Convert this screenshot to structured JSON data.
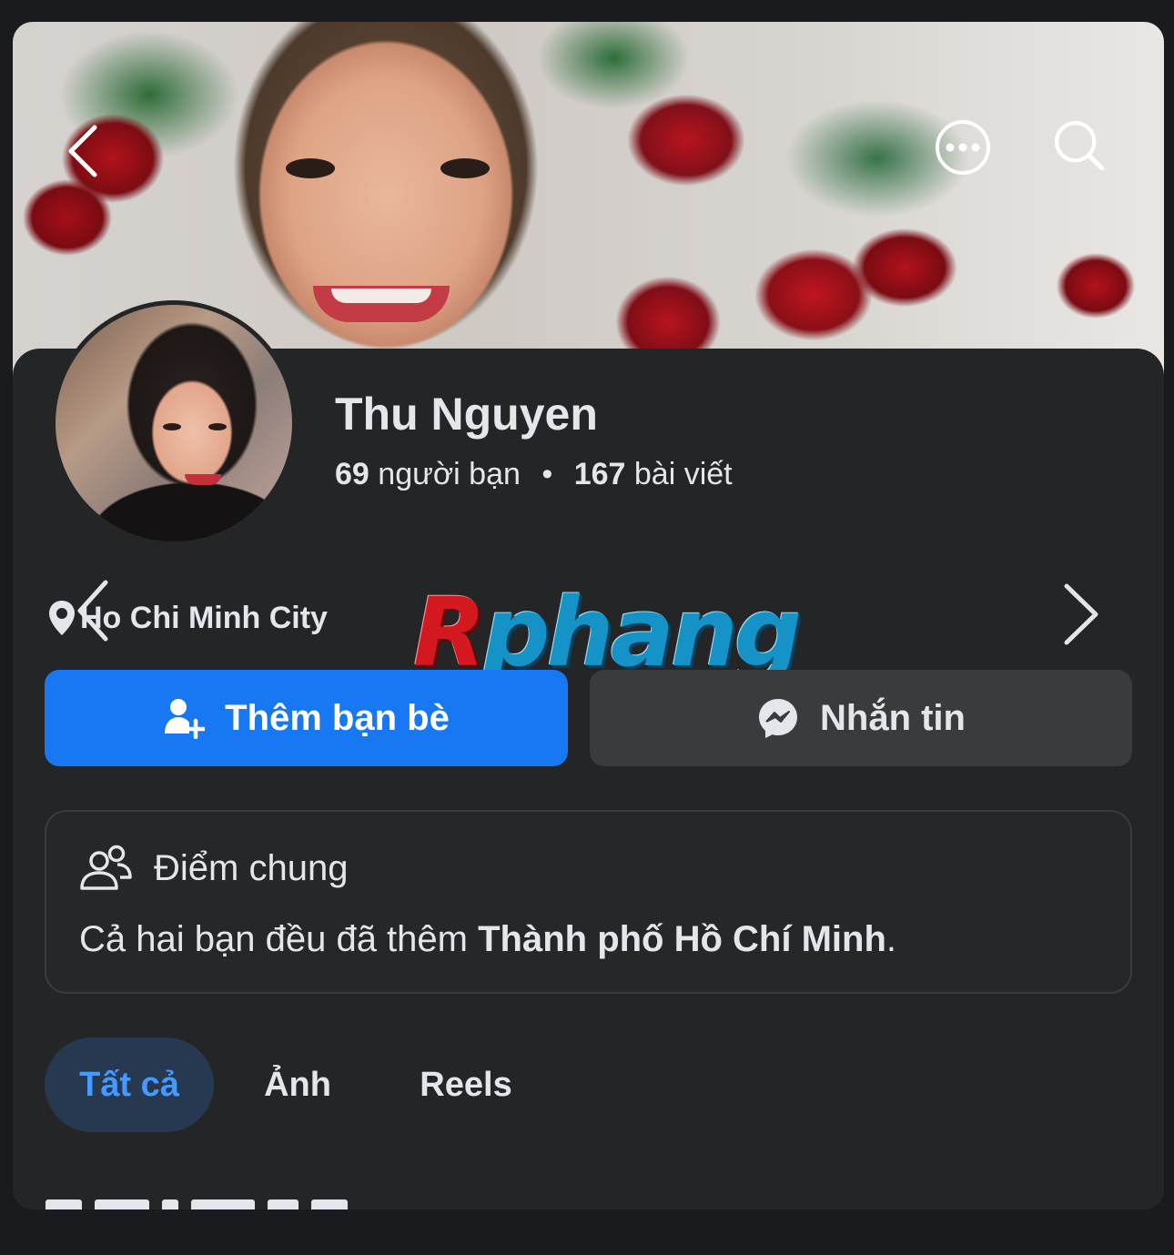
{
  "header": {
    "back_icon": "chevron-left-icon",
    "more_icon": "more-dots-icon",
    "search_icon": "search-icon"
  },
  "profile": {
    "name": "Thu Nguyen",
    "friends_count": "69",
    "friends_label": "người bạn",
    "posts_count": "167",
    "posts_label": "bài viết"
  },
  "location": {
    "text": "Ho Chi Minh City",
    "pin_icon": "location-pin-icon",
    "prev_icon": "chevron-left-icon",
    "next_icon": "chevron-right-icon"
  },
  "watermark": {
    "first": "R",
    "rest": "phang"
  },
  "actions": {
    "add_friend_label": "Thêm bạn bè",
    "message_label": "Nhắn tin",
    "add_friend_color": "#1877f2"
  },
  "common": {
    "title": "Điểm chung",
    "text_prefix": "Cả hai bạn đều đã thêm ",
    "place": "Thành phố Hồ Chí Minh",
    "text_suffix": "."
  },
  "tabs": [
    {
      "label": "Tất cả",
      "active": true
    },
    {
      "label": "Ảnh",
      "active": false
    },
    {
      "label": "Reels",
      "active": false
    }
  ],
  "colors": {
    "background": "#242527",
    "active_tab_text": "#4599ff",
    "active_tab_bg": "#263951"
  }
}
